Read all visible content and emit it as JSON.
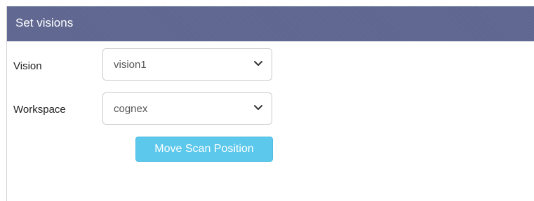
{
  "panel": {
    "title": "Set visions"
  },
  "form": {
    "vision": {
      "label": "Vision",
      "selected": "vision1",
      "chevron_icon": "chevron-down-icon"
    },
    "workspace": {
      "label": "Workspace",
      "selected": "cognex",
      "chevron_icon": "chevron-down-icon"
    }
  },
  "actions": {
    "move_scan_label": "Move Scan Position"
  },
  "colors": {
    "header_bg": "#5e6690",
    "button_bg": "#5bc8ec",
    "select_border": "#c9c9c9"
  }
}
